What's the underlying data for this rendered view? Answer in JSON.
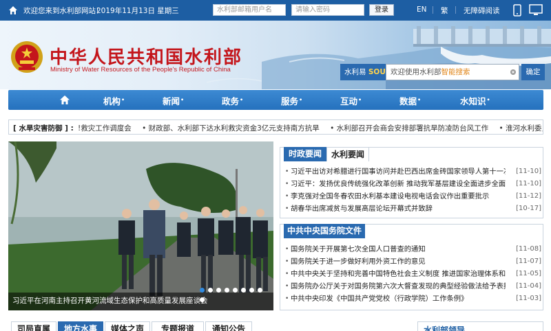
{
  "topbar": {
    "welcome": "欢迎您来到水利部网站！",
    "date": "2019年11月13日 星期三",
    "username_placeholder": "水利部邮箱用户名",
    "password_placeholder": "请输入密码",
    "login_label": "登录",
    "lang_en": "EN",
    "lang_trad": "繁",
    "accessible": "无障碍阅读"
  },
  "header": {
    "title_cn": "中华人民共和国水利部",
    "title_en": "Ministry of Water Resources of the People's Republic of China",
    "search_brand": "水利易",
    "search_brand_mark": "SOU",
    "search_prefix": "欢迎使用水利部",
    "search_highlight": "智能搜索",
    "search_button": "确定"
  },
  "nav": {
    "items": [
      {
        "label": "机构"
      },
      {
        "label": "新闻"
      },
      {
        "label": "政务"
      },
      {
        "label": "服务"
      },
      {
        "label": "互动"
      },
      {
        "label": "数据"
      },
      {
        "label": "水知识"
      }
    ],
    "marker": "•"
  },
  "notice": {
    "label": "[ 水旱灾害防御 ] :",
    "items": [
      "!救灾工作调度会",
      "• 财政部、水利部下达水利救灾资金3亿元支持南方抗旱",
      "• 水利部召开会商会安排部署抗旱防凌防台风工作",
      "• 淮河水利委员会贯彻中央"
    ]
  },
  "slider": {
    "caption": "习近平在河南主持召开黄河流域生态保护和高质量发展座谈会",
    "dot_count": 9,
    "active_dot": 0
  },
  "news": {
    "tabs": [
      {
        "label": "时政要闻",
        "active": true
      },
      {
        "label": "水利要闻",
        "active": false
      }
    ],
    "items": [
      {
        "title": "习近平出访对希腊进行国事访问并赴巴西出席金砖国家领导人第十一次会晤",
        "date": "[11-10]"
      },
      {
        "title": "习近平：发扬优良传统强化改革创新 推动我军基层建设全面进步全面过硬",
        "date": "[11-10]"
      },
      {
        "title": "李克强对全国冬春农田水利基本建设电视电话会议作出重要批示",
        "date": "[11-12]"
      },
      {
        "title": "胡春华出席减贫与发展高层论坛开幕式并致辞",
        "date": "[10-17]"
      }
    ]
  },
  "council": {
    "tab": "中共中央国务院文件",
    "items": [
      {
        "title": "国务院关于开展第七次全国人口普查的通知",
        "date": "[11-08]"
      },
      {
        "title": "国务院关于进一步做好利用外资工作的意见",
        "date": "[11-07]"
      },
      {
        "title": "中共中央关于坚持和完善中国特色社会主义制度 推进国家治理体系和治...",
        "date": "[11-05]"
      },
      {
        "title": "国务院办公厅关于对国务院第六次大督查发现的典型经验做法给予表扬...",
        "date": "[11-04]"
      },
      {
        "title": "中共中央印发《中国共产党党校（行政学院）工作条例》",
        "date": "[11-03]"
      }
    ]
  },
  "bottom": {
    "tabs": [
      {
        "label": "司局直属",
        "active": false
      },
      {
        "label": "地方水事",
        "active": true
      },
      {
        "label": "媒体之声",
        "active": false
      },
      {
        "label": "专题报道",
        "active": false
      },
      {
        "label": "通知公告",
        "active": false
      }
    ],
    "leader_title": "水利部领导"
  },
  "colors": {
    "brand_blue": "#1d5ea3",
    "title_red": "#c4161c",
    "search_orange": "#e0861a"
  }
}
